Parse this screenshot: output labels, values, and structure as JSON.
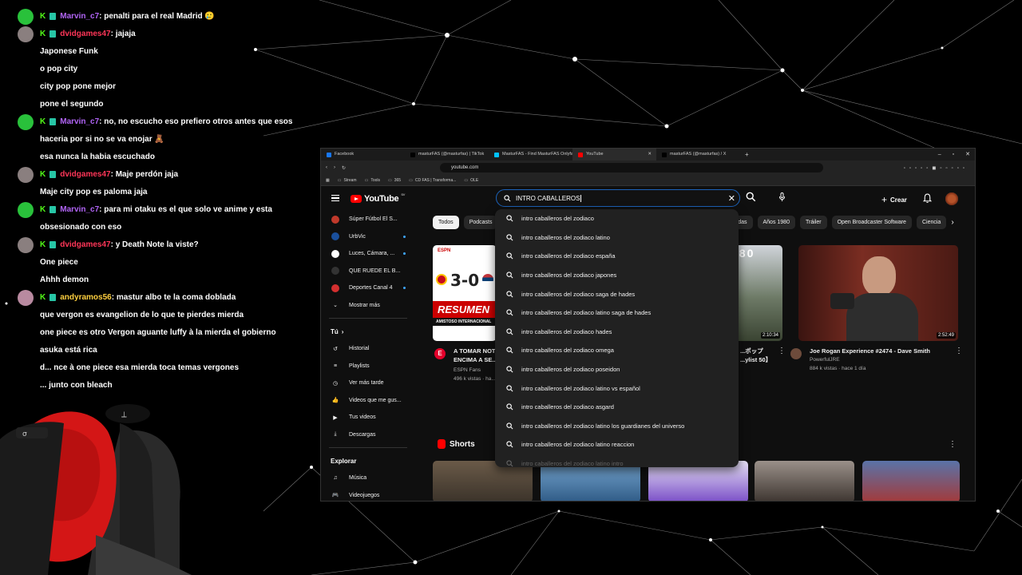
{
  "chat": {
    "messages": [
      {
        "user": "Marvin_c7",
        "text": ": penalti para el real Madrid 🥲",
        "avatar": "green",
        "color": "#b265f7"
      },
      {
        "user": "dvidgames47",
        "text": ": jajaja",
        "avatar": "gray",
        "color": "#ff3658"
      },
      {
        "text": "Japonese Funk"
      },
      {
        "text": "o pop city"
      },
      {
        "text": "city pop pone mejor"
      },
      {
        "text": "pone el segundo"
      },
      {
        "user": "Marvin_c7",
        "text": ": no, no escucho eso prefiero otros antes que esos",
        "avatar": "green",
        "color": "#b265f7"
      },
      {
        "text": "haceria por si no se va enojar 🧸"
      },
      {
        "text": "esa nunca la habia escuchado"
      },
      {
        "user": "dvidgames47",
        "text": ": Maje perdón jaja",
        "avatar": "gray",
        "color": "#ff3658"
      },
      {
        "text": "Maje city pop es paloma jaja"
      },
      {
        "user": "Marvin_c7",
        "text": ": para mi otaku es el que solo ve anime y esta",
        "avatar": "green",
        "color": "#b265f7"
      },
      {
        "text": "obsesionado con eso"
      },
      {
        "user": "dvidgames47",
        "text": ": y Death Note la viste?",
        "avatar": "gray",
        "color": "#ff3658"
      },
      {
        "text": "One piece"
      },
      {
        "text": "Ahhh demon"
      },
      {
        "user": "andyramos56",
        "text": ": mastur albo te la coma doblada",
        "avatar": "pink",
        "color": "#ffcf3f"
      },
      {
        "text": "que vergon es evangelion de lo que te pierdes mierda"
      },
      {
        "text": "one piece es otro Vergon aguante luffy à la mierda el gobierno"
      },
      {
        "text": "asuka está rica"
      },
      {
        "text": "d... nce à one piece esa mierda toca temas vergones"
      },
      {
        "text": "... junto con bleach"
      }
    ]
  },
  "browser": {
    "tabs": [
      {
        "label": "Facebook",
        "color": "#1877f2"
      },
      {
        "label": "masturFAS (@masturfas) | TikTok",
        "color": "#000000"
      },
      {
        "label": "MasturFAS - Find MasturFAS Onlyfa",
        "color": "#00c2ff"
      },
      {
        "label": "YouTube",
        "color": "#ff0000",
        "active": true
      },
      {
        "label": "masturFAS (@masturfas) / X",
        "color": "#000000"
      }
    ],
    "url": "youtube.com",
    "bookmarks": [
      "Stream",
      "Tools",
      "365",
      "CD FAS | Transforma...",
      "OLE"
    ]
  },
  "youtube": {
    "logo": "YouTube",
    "country": "SV",
    "search_value": "INTRO CABALLEROS",
    "create_label": "Crear",
    "sidebar": {
      "subs": [
        "Súper Fútbol El S...",
        "UrbVic",
        "Luces, Cámara, ...",
        "QUE RUEDE EL B...",
        "Deportes Canal 4"
      ],
      "more": "Mostrar más",
      "you_head": "Tú",
      "you_items": [
        "Historial",
        "Playlists",
        "Ver más tarde",
        "Videos que me gus...",
        "Tus videos",
        "Descargas"
      ],
      "explore_head": "Explorar",
      "explore_items": [
        "Música",
        "Videojuegos"
      ]
    },
    "chips": [
      "Todos",
      "Podcasts",
      "...adas",
      "Años 1980",
      "Tráiler",
      "Open Broadcaster Software",
      "Ciencia"
    ],
    "suggestions": [
      "intro caballeros del zodiaco",
      "intro caballeros del zodiaco latino",
      "intro caballeros del zodiaco españa",
      "intro caballeros del zodiaco japones",
      "intro caballeros del zodiaco saga de hades",
      "intro caballeros del zodiaco latino saga de hades",
      "intro caballeros del zodiaco hades",
      "intro caballeros del zodiaco omega",
      "intro caballeros del zodiaco poseidon",
      "intro caballeros del zodiaco latino vs español",
      "intro caballeros del zodiaco asgard",
      "intro caballeros del zodiaco latino los guardianes del universo",
      "intro caballeros del zodiaco latino reaccion",
      "intro caballeros del zodiaco latino intro"
    ],
    "videos": [
      {
        "title1": "A TOMAR NOT...",
        "title2": "ENCIMA A SE...",
        "channel": "ESPN Fans",
        "meta": "496 k vistas · ha...",
        "thumb_text": "3-0",
        "thumb_sub": "RESUMEN",
        "thumb_sub2": "AMISTOSO INTERNACIONAL",
        "logo": "ESPN"
      },
      {
        "title1": "...ポップ",
        "title2": "...ylist 50】",
        "duration": "2:10:34",
        "thumb_text": "980"
      },
      {
        "title1": "Joe Rogan Experience #2474 - Dave Smith",
        "channel": "PowerfulJRE",
        "meta": "884 k vistas · hace 1 día",
        "duration": "2:52:49"
      }
    ],
    "shorts_label": "Shorts"
  },
  "colors": {
    "accent": "#3ea6ff",
    "youtube_red": "#ff0000",
    "search_border": "#1c62b9"
  }
}
